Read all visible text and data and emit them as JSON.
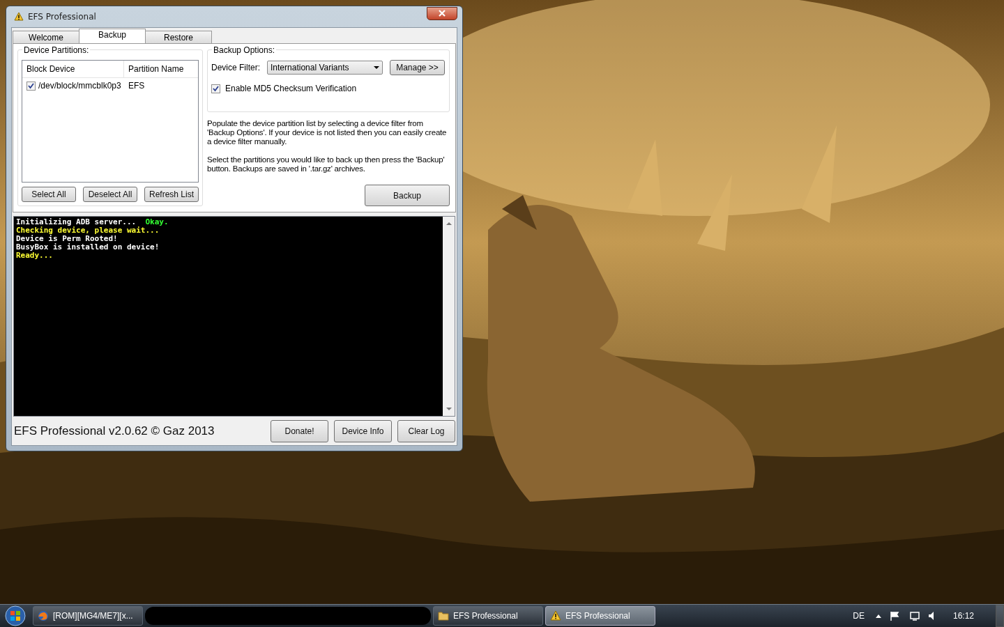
{
  "window": {
    "title": "EFS Professional"
  },
  "tabs": [
    {
      "label": "Welcome",
      "selected": false
    },
    {
      "label": "Backup",
      "selected": true
    },
    {
      "label": "Restore",
      "selected": false
    }
  ],
  "partitions": {
    "title": "Device Partitions:",
    "columns": [
      "Block Device",
      "Partition Name"
    ],
    "rows": [
      {
        "block_device": "/dev/block/mmcblk0p3",
        "partition_name": "EFS",
        "checked": true
      }
    ],
    "buttons": [
      "Select All",
      "Deselect All",
      "Refresh List"
    ]
  },
  "backup_options": {
    "title": "Backup Options:",
    "filter_label": "Device Filter:",
    "filter_value": "International Variants",
    "manage_button": "Manage >>",
    "md5": {
      "label": "Enable MD5 Checksum Verification",
      "checked": true
    }
  },
  "help_texts": [
    "Populate the device partition list by selecting a device filter from 'Backup Options'. If your device is not listed then you can easily create a device filter manually.",
    "Select the partitions you would like to back up then press the 'Backup' button. Backups are saved in '.tar.gz' archives."
  ],
  "backup_button": "Backup",
  "console": {
    "lines": [
      {
        "segments": [
          {
            "text": "Initializing ADB server...  ",
            "color": "#ffffff"
          },
          {
            "text": "Okay.",
            "color": "#33ff33"
          }
        ]
      },
      {
        "segments": [
          {
            "text": "Checking device, please wait...",
            "color": "#ffff33"
          }
        ]
      },
      {
        "segments": [
          {
            "text": "Device is Perm Rooted!",
            "color": "#ffffff"
          }
        ]
      },
      {
        "segments": [
          {
            "text": "BusyBox is installed on device!",
            "color": "#ffffff"
          }
        ]
      },
      {
        "segments": [
          {
            "text": "Ready...",
            "color": "#ffff33"
          }
        ]
      }
    ]
  },
  "footer": {
    "credit": "EFS Professional v2.0.62 © Gaz 2013",
    "buttons": [
      "Donate!",
      "Device Info",
      "Clear Log"
    ]
  },
  "taskbar": {
    "items": [
      {
        "label": "[ROM][MG4/ME7][x...",
        "kind": "browser",
        "selected": false
      },
      {
        "label": "EFS Professional",
        "kind": "folder",
        "selected": false
      },
      {
        "label": "EFS Professional",
        "kind": "warning",
        "selected": true
      }
    ],
    "language": "DE",
    "clock": "16:12"
  }
}
